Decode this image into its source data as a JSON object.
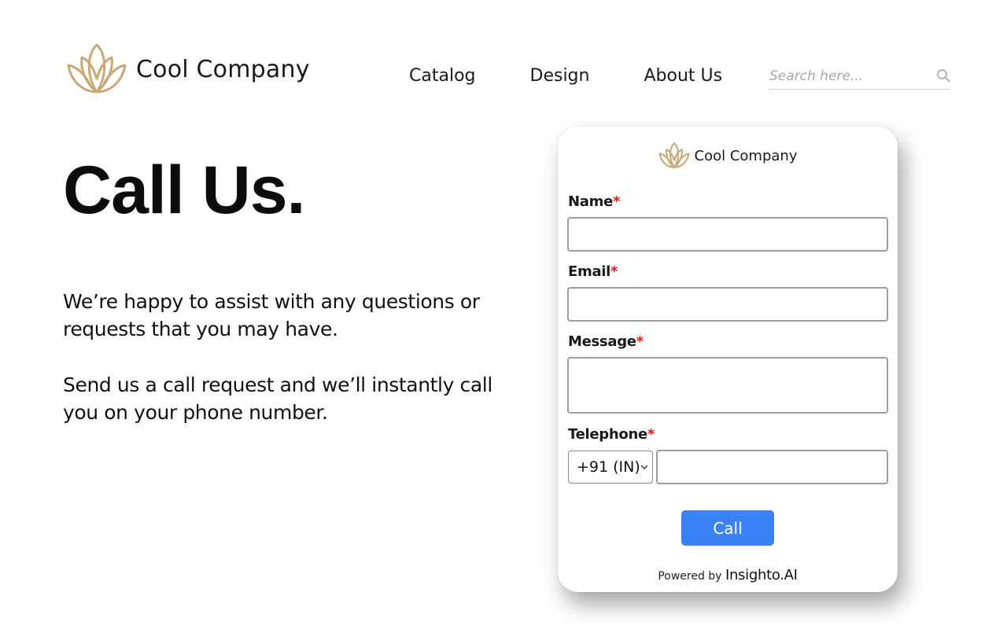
{
  "brand": {
    "name": "Cool Company",
    "accent": "#c8a874"
  },
  "nav": {
    "items": [
      "Catalog",
      "Design",
      "About Us"
    ]
  },
  "search": {
    "placeholder": "Search here...",
    "icon": "search-icon"
  },
  "hero": {
    "title": "Call Us.",
    "paragraph_1": "We’re happy to assist with any questions or requests that you may have.",
    "paragraph_2": "Send us a call request and we’ll instantly call you on your phone number."
  },
  "widget": {
    "brand_name": "Cool Company",
    "required_mark": "*",
    "fields": {
      "name": {
        "label": "Name",
        "value": ""
      },
      "email": {
        "label": "Email",
        "value": ""
      },
      "message": {
        "label": "Message",
        "value": ""
      },
      "telephone": {
        "label": "Telephone",
        "country_code": "+91 (IN)",
        "value": ""
      }
    },
    "submit_label": "Call",
    "button_color": "#3b82f6",
    "required_color": "#e21a1a",
    "powered_prefix": "Powered by",
    "powered_brand": "Insighto.AI"
  }
}
